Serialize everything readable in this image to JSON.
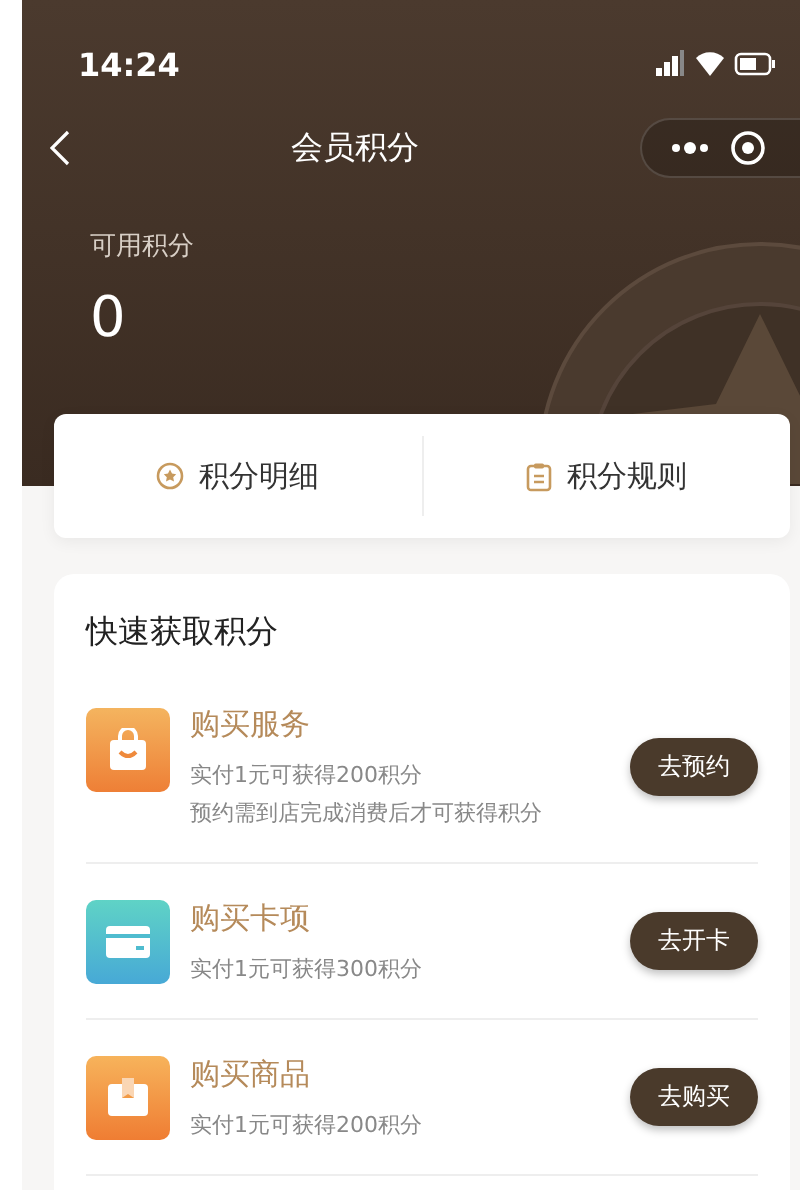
{
  "status_bar": {
    "time": "14:24"
  },
  "nav": {
    "title": "会员积分"
  },
  "points": {
    "label": "可用积分",
    "value": "0"
  },
  "tabs": [
    {
      "label": "积分明细",
      "kind": "star"
    },
    {
      "label": "积分规则",
      "kind": "clipboard"
    }
  ],
  "quick": {
    "title": "快速获取积分",
    "items": [
      {
        "kind": "bag",
        "title": "购买服务",
        "lines": [
          "实付1元可获得200积分",
          "预约需到店完成消费后才可获得积分"
        ],
        "button": "去预约"
      },
      {
        "kind": "card",
        "title": "购买卡项",
        "lines": [
          "实付1元可获得300积分"
        ],
        "button": "去开卡"
      },
      {
        "kind": "box",
        "title": "购买商品",
        "lines": [
          "实付1元可获得200积分"
        ],
        "button": "去购买"
      }
    ]
  }
}
